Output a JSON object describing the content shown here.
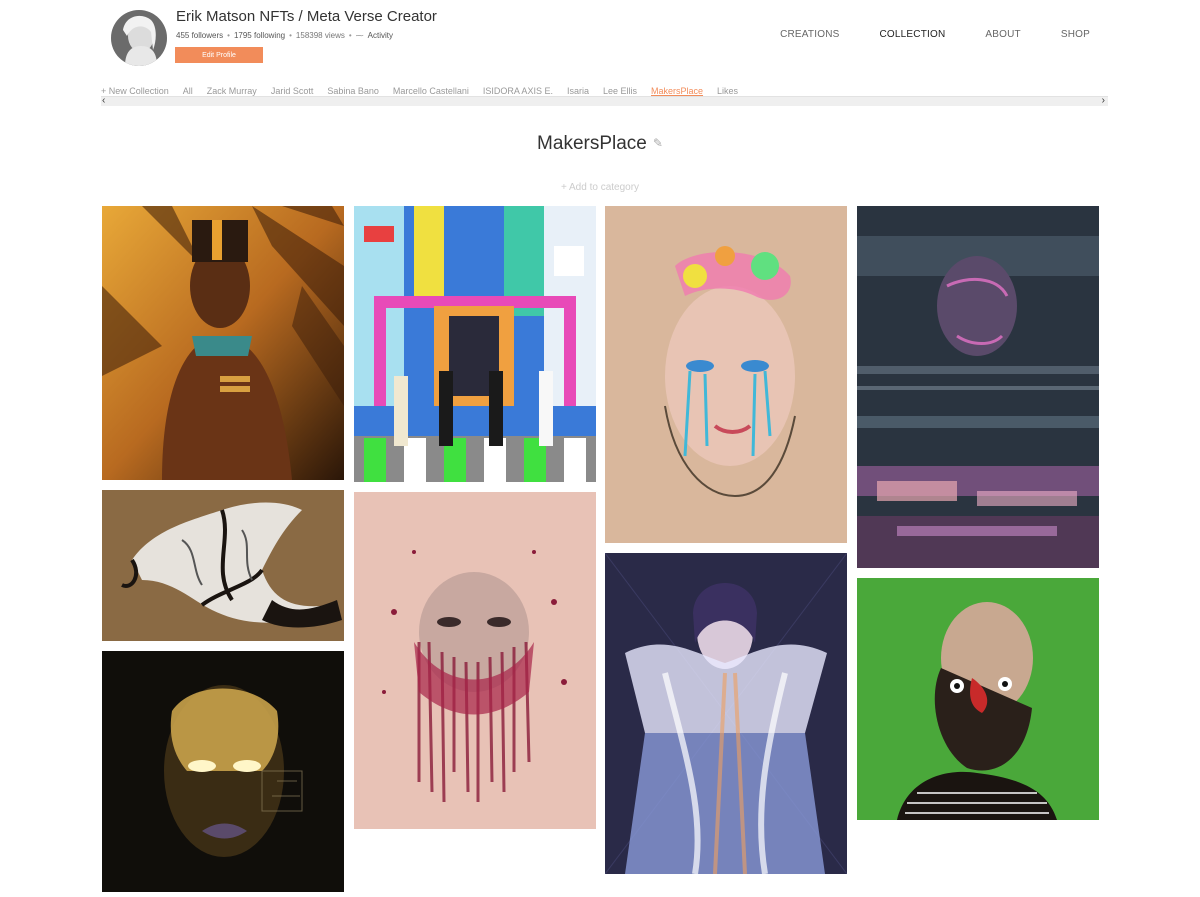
{
  "profile": {
    "name": "Erik Matson NFTs / Meta Verse Creator",
    "followers": "455 followers",
    "following": "1795 following",
    "views": "158398 views",
    "activity": "Activity",
    "edit_label": "Edit Profile"
  },
  "nav": {
    "items": [
      "CREATIONS",
      "COLLECTION",
      "ABOUT",
      "SHOP"
    ],
    "active": "COLLECTION"
  },
  "collections": {
    "new_label": "+ New Collection",
    "items": [
      "All",
      "Zack Murray",
      "Jarid Scott",
      "Sabina Bano",
      "Marcello Castellani",
      "ISIDORA AXIS E.",
      "Isaria",
      "Lee Ellis",
      "MakersPlace",
      "Likes"
    ],
    "active": "MakersPlace"
  },
  "page": {
    "title": "MakersPlace",
    "add_category": "+ Add to category"
  },
  "colors": {
    "accent": "#f28c5a"
  },
  "artworks": [
    {
      "name": "artwork-egyptian-queen",
      "bg": "#c98a2a",
      "fg": "#3a1c0c"
    },
    {
      "name": "artwork-abstract-torso",
      "bg": "#8a6a44",
      "fg": "#e8e4de"
    },
    {
      "name": "artwork-golden-face",
      "bg": "#14110c",
      "fg": "#c9a24a"
    },
    {
      "name": "artwork-city-crosswalk",
      "bg": "#3a8ad8",
      "fg": "#e84aa8"
    },
    {
      "name": "artwork-crimson-faces",
      "bg": "#e8c0b4",
      "fg": "#8a1c3a"
    },
    {
      "name": "artwork-paint-drip-face",
      "bg": "#d8b498",
      "fg": "#5ac8d8"
    },
    {
      "name": "artwork-neon-girl",
      "bg": "#3a3a5a",
      "fg": "#c8c8f0"
    },
    {
      "name": "artwork-glitch-portrait",
      "bg": "#2a3440",
      "fg": "#c86ab4"
    },
    {
      "name": "artwork-green-figure",
      "bg": "#4aa83a",
      "fg": "#c8a890"
    }
  ]
}
